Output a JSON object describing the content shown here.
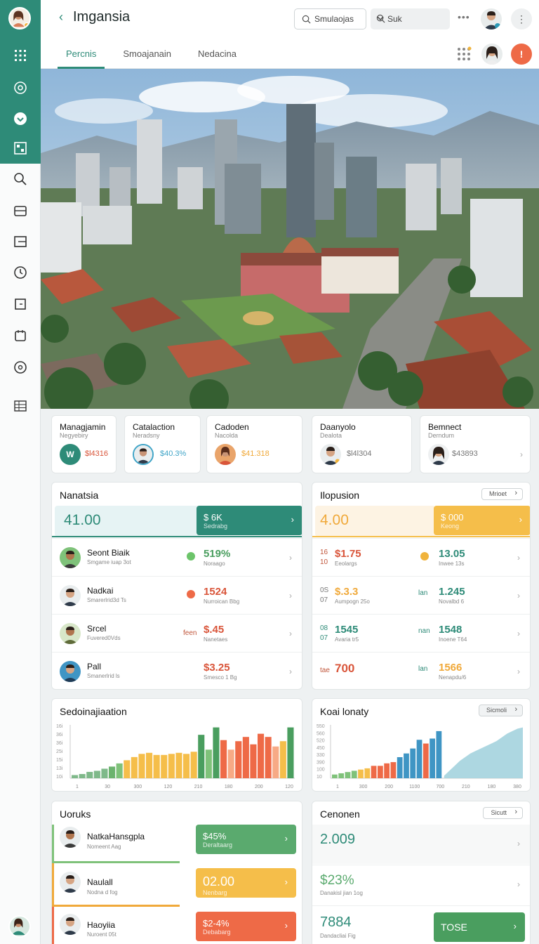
{
  "app": {
    "title": "Imgansia"
  },
  "header": {
    "search_label": "Smulaojas",
    "select_label": "Suk",
    "more_glyph": "•••",
    "kebab_glyph": "⋮",
    "alert_glyph": "!"
  },
  "tabs": [
    {
      "label": "Percnis",
      "active": true
    },
    {
      "label": "Smoajanain",
      "active": false
    },
    {
      "label": "Nedacina",
      "active": false
    }
  ],
  "colors": {
    "accent": "#2e8b78",
    "green": "#5aaa6e",
    "orange": "#ee6a47",
    "yellow": "#f5be4a",
    "red": "#d9553a",
    "blue": "#3f95c4"
  },
  "stats": [
    {
      "title": "Managjamin",
      "sub": "Negyebiry",
      "avatar_letter": "W",
      "value": "$l4316",
      "color": "#d9553a"
    },
    {
      "title": "Catalaction",
      "sub": "Neradsny",
      "value": "$40.3%",
      "color": "#3fa4c7"
    },
    {
      "title": "Cadoden",
      "sub": "Nacolda",
      "value": "$41.318",
      "color": "#f0a93a"
    },
    {
      "title": "Daanyolo",
      "sub": "Dealota",
      "value": "$l4l304",
      "color": "#777"
    },
    {
      "title": "Bemnect",
      "sub": "Derndum",
      "value": "$43893",
      "color": "#777"
    }
  ],
  "left_panel": {
    "title": "Nanatsia",
    "big_value": "41.00",
    "highlight": {
      "value": "$ 6K",
      "sub": "Sedrabg"
    },
    "rows": [
      {
        "name": "Seont Biaik",
        "sub": "Smgame iuap 3ot",
        "tag": "",
        "value": "519%",
        "vsub": "Noraago",
        "vcolor": "#4a9e5f",
        "dot": "#6cc46a"
      },
      {
        "name": "Nadkai",
        "sub": "Smarerlrid3d Ts",
        "tag": "",
        "value": "1524",
        "vsub": "Nurroican Bbg",
        "vcolor": "#d9553a",
        "dot": "#ee6a47"
      },
      {
        "name": "Srcel",
        "sub": "Fuvered0Vds",
        "tag": "feen",
        "value": "$.45",
        "vsub": "Nanetaes",
        "vcolor": "#d9553a",
        "dot": ""
      },
      {
        "name": "Pall",
        "sub": "Smanerlrid ls",
        "tag": "",
        "value": "$3.25",
        "vsub": "Smesco 1 Bg",
        "vcolor": "#d9553a",
        "dot": ""
      }
    ]
  },
  "right_panel": {
    "title": "Ilopusion",
    "button": "Mrioet",
    "big_value": "4.00",
    "highlight": {
      "value": "$ 000",
      "sub": "Keong"
    },
    "rows": [
      {
        "pre1": "16",
        "pre2": "10",
        "v1": "$1.75",
        "s1": "Eeolargs",
        "c1": "#d9553a",
        "mid": "",
        "dot": "#f0b33c",
        "v2": "13.05",
        "s2": "Inwee 13s",
        "c2": "#2e8b78"
      },
      {
        "pre1": "0S",
        "pre2": "07",
        "v1": "$.3.3",
        "s1": "Aumpogn 25o",
        "c1": "#f0a93a",
        "mid": "lan",
        "dot": "",
        "v2": "1.245",
        "s2": "Novalbd 6",
        "c2": "#2e8b78"
      },
      {
        "pre1": "08",
        "pre2": "07",
        "v1": "1545",
        "s1": "Avaria tr5",
        "c1": "#2e8b78",
        "mid": "nan",
        "dot": "",
        "v2": "1548",
        "s2": "Inoene T64",
        "c2": "#2e8b78"
      },
      {
        "pre1": "tae",
        "pre2": "",
        "v1": "700",
        "s1": "",
        "c1": "#d9553a",
        "mid": "lan",
        "dot": "",
        "v2": "1566",
        "s2": "Nenapdu/6",
        "c2": "#f0a93a"
      }
    ]
  },
  "chart_data": [
    {
      "type": "bar",
      "title": "Sedoinajiaation",
      "ylabels": [
        "16i",
        "36i",
        "36i",
        "25i",
        "15i",
        "13i",
        "10i"
      ],
      "xlabels": [
        "1",
        "30",
        "300",
        "120",
        "210",
        "180",
        "200",
        "120"
      ],
      "values": [
        3,
        4,
        6,
        7,
        9,
        11,
        14,
        17,
        20,
        23,
        24,
        22,
        22,
        23,
        24,
        23,
        25,
        41,
        27,
        48,
        36,
        27,
        35,
        39,
        32,
        42,
        39,
        30,
        35,
        48
      ],
      "colors": [
        "#7fb98a",
        "#7fb98a",
        "#7fb98a",
        "#7fb98a",
        "#7fb98a",
        "#6cb36e",
        "#7fc27a",
        "#f5be4a",
        "#f5be4a",
        "#f5be4a",
        "#f5be4a",
        "#f5be4a",
        "#f5be4a",
        "#f5be4a",
        "#f5be4a",
        "#f5be4a",
        "#f5be4a",
        "#4a9e5f",
        "#7fc27a",
        "#4a9e5f",
        "#ee6a47",
        "#f7aa85",
        "#ee6a47",
        "#ee6a47",
        "#ee6a47",
        "#ee6a47",
        "#ee6a47",
        "#f7aa85",
        "#f5be4a",
        "#4a9e5f"
      ]
    },
    {
      "type": "bar",
      "title": "Koai lonaty",
      "button": "Sicmoli",
      "ylabels": [
        "550",
        "560",
        "520",
        "450",
        "330",
        "390",
        "100",
        "10"
      ],
      "xlabels": [
        "1",
        "300",
        "200",
        "1100",
        "700",
        "210",
        "180",
        "380"
      ],
      "values": [
        3,
        4,
        5,
        6,
        7,
        8,
        10,
        10,
        12,
        13,
        17,
        20,
        24,
        31,
        28,
        32,
        38
      ],
      "colors": [
        "#7fc27a",
        "#7fc27a",
        "#7fc27a",
        "#7fc27a",
        "#f5be4a",
        "#f5be4a",
        "#ee6a47",
        "#ee6a47",
        "#ee6a47",
        "#ee6a47",
        "#3f95c4",
        "#3f95c4",
        "#3f95c4",
        "#3f95c4",
        "#ee6a47",
        "#3f95c4",
        "#3f95c4"
      ],
      "area": [
        2,
        6,
        10,
        14,
        17,
        20,
        22,
        24,
        26,
        28,
        30,
        33,
        36,
        38,
        40,
        41
      ]
    }
  ],
  "bottom_left": {
    "title": "Uoruks",
    "items": [
      {
        "name": "NatkaHansgpla",
        "sub": "Nomeent Aag",
        "value": "$45%",
        "vsub": "Deraltaarg",
        "color": "#5aaa6e",
        "bar": "#7fc27a"
      },
      {
        "name": "Naulall",
        "sub": "Nodna d fog",
        "value": "02.00",
        "vsub": "Nenbarg",
        "color": "#f5be4a",
        "bar": "#f0a93a"
      },
      {
        "name": "Haoyiia",
        "sub": "Nuroent 05t",
        "value": "$2-4%",
        "vsub": "Debabarg",
        "color": "#ee6a47",
        "bar": "#ee6a47"
      }
    ]
  },
  "bottom_right": {
    "title": "Cenonen",
    "button": "Sicutt",
    "items": [
      {
        "value": "2.009",
        "sub": "",
        "color": "#2e8b78"
      },
      {
        "value": "$23%",
        "sub": "Danakisl jian 1og",
        "color": "#5aaa6e"
      },
      {
        "value": "7884",
        "sub": "Dandacliai Fig",
        "color": "#2e8b78"
      }
    ],
    "action": "TOSE"
  }
}
